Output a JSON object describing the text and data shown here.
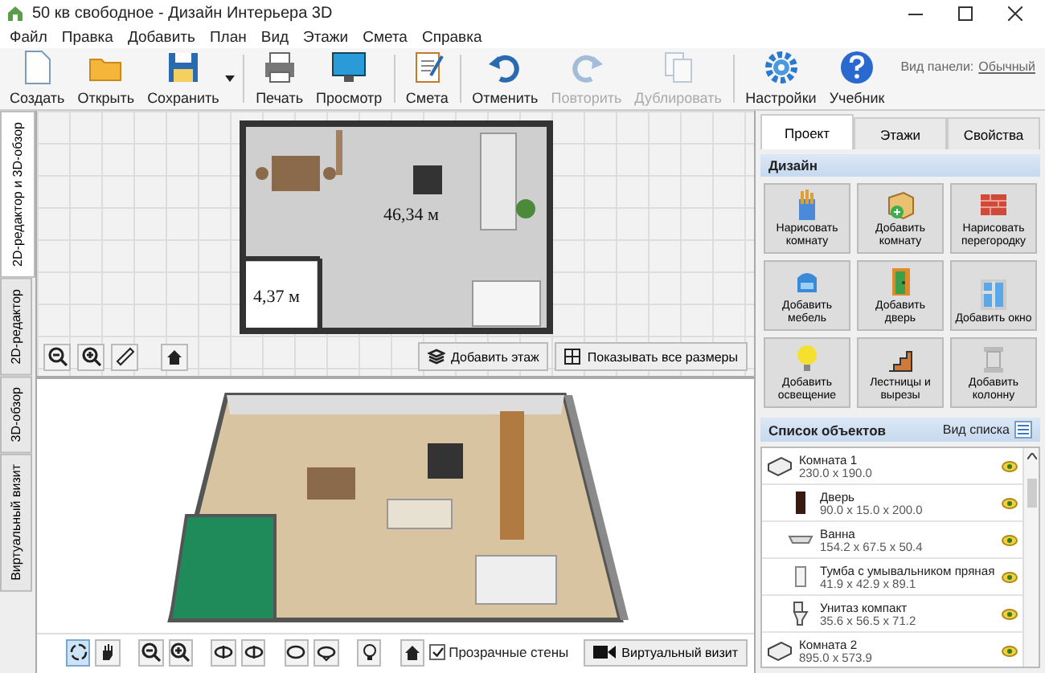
{
  "window": {
    "title": "50 кв свободное - Дизайн Интерьера 3D"
  },
  "menu": [
    "Файл",
    "Правка",
    "Добавить",
    "План",
    "Вид",
    "Этажи",
    "Смета",
    "Справка"
  ],
  "toolbar": [
    {
      "label": "Создать",
      "disabled": false,
      "dropdown": false
    },
    {
      "label": "Открыть",
      "disabled": false,
      "dropdown": false
    },
    {
      "label": "Сохранить",
      "disabled": false,
      "dropdown": true
    },
    {
      "label": "Печать",
      "disabled": false,
      "dropdown": false
    },
    {
      "label": "Просмотр",
      "disabled": false,
      "dropdown": false
    },
    {
      "label": "Смета",
      "disabled": false,
      "dropdown": false
    },
    {
      "label": "Отменить",
      "disabled": false,
      "dropdown": false
    },
    {
      "label": "Повторить",
      "disabled": true,
      "dropdown": false
    },
    {
      "label": "Дублировать",
      "disabled": true,
      "dropdown": false
    },
    {
      "label": "Настройки",
      "disabled": false,
      "dropdown": false
    },
    {
      "label": "Учебник",
      "disabled": false,
      "dropdown": false
    }
  ],
  "panel_view": {
    "label": "Вид панели:",
    "value": "Обычный"
  },
  "side_tabs": [
    {
      "label": "2D-редактор и 3D-обзор",
      "selected": true
    },
    {
      "label": "2D-редактор",
      "selected": false
    },
    {
      "label": "3D-обзор",
      "selected": false
    },
    {
      "label": "Виртуальный визит",
      "selected": false
    }
  ],
  "plan": {
    "rooms": [
      "46,34 м",
      "4,37 м"
    ],
    "buttons": [
      "Добавить этаж",
      "Показывать все размеры"
    ]
  },
  "view3d": {
    "transparent_walls": {
      "label": "Прозрачные стены",
      "checked": true
    },
    "tour_button": "Виртуальный визит"
  },
  "right_tabs": [
    {
      "label": "Проект",
      "selected": true
    },
    {
      "label": "Этажи",
      "selected": false
    },
    {
      "label": "Свойства",
      "selected": false
    }
  ],
  "design": {
    "title": "Дизайн",
    "buttons": [
      "Нарисовать комнату",
      "Добавить комнату",
      "Нарисовать перегородку",
      "Добавить мебель",
      "Добавить дверь",
      "Добавить окно",
      "Добавить освещение",
      "Лестницы и вырезы",
      "Добавить колонну"
    ]
  },
  "objects": {
    "title": "Список объектов",
    "view_label": "Вид списка",
    "items": [
      {
        "name": "Комната 1",
        "size": "230.0 x 190.0",
        "visible": true,
        "children": [
          {
            "name": "Дверь",
            "size": "90.0 x 15.0 x 200.0",
            "visible": true
          },
          {
            "name": "Ванна",
            "size": "154.2 x 67.5 x 50.4",
            "visible": true
          },
          {
            "name": "Тумба с умывальником пряная",
            "size": "41.9 x 42.9 x 89.1",
            "visible": true
          },
          {
            "name": "Унитаз компакт",
            "size": "35.6 x 56.5 x 71.2",
            "visible": true
          }
        ]
      },
      {
        "name": "Комната 2",
        "size": "895.0 x 573.9",
        "visible": true
      }
    ]
  }
}
